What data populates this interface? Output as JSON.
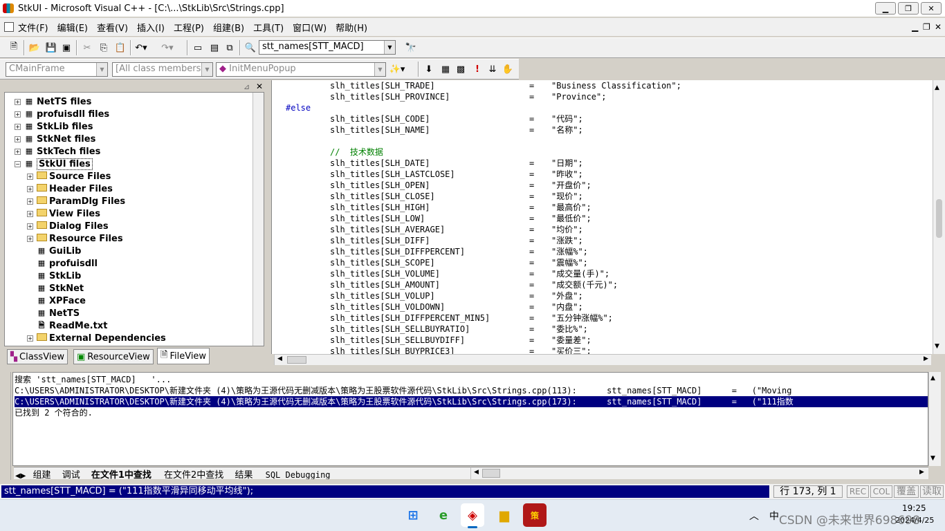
{
  "window": {
    "title": "StkUI - Microsoft Visual C++ - [C:\\...\\StkLib\\Src\\Strings.cpp]"
  },
  "menu": [
    "文件(F)",
    "编辑(E)",
    "查看(V)",
    "插入(I)",
    "工程(P)",
    "组建(B)",
    "工具(T)",
    "窗口(W)",
    "帮助(H)"
  ],
  "toolbar1": {
    "find_combo": "stt_names[STT_MACD]"
  },
  "toolbar2": {
    "class_combo": "CMainFrame",
    "filter_combo": "[All class members]",
    "member_combo": "InitMenuPopup"
  },
  "workspace": {
    "tree": [
      {
        "label": "NetTS files"
      },
      {
        "label": "profuisdll files"
      },
      {
        "label": "StkLib files"
      },
      {
        "label": "StkNet files"
      },
      {
        "label": "StkTech files"
      },
      {
        "label": "StkUI files"
      },
      {
        "label": "Source Files"
      },
      {
        "label": "Header Files"
      },
      {
        "label": "ParamDlg Files"
      },
      {
        "label": "View Files"
      },
      {
        "label": "Dialog Files"
      },
      {
        "label": "Resource Files"
      },
      {
        "label": "GuiLib"
      },
      {
        "label": "profuisdll"
      },
      {
        "label": "StkLib"
      },
      {
        "label": "StkNet"
      },
      {
        "label": "XPFace"
      },
      {
        "label": "NetTS"
      },
      {
        "label": "ReadMe.txt"
      },
      {
        "label": "External Dependencies"
      }
    ],
    "tabs": [
      "ClassView",
      "ResourceView",
      "FileView"
    ]
  },
  "editor": {
    "lines": [
      {
        "key": "slh_titles[SLH_TRADE]",
        "val": "\"Business Classification\";"
      },
      {
        "key": "slh_titles[SLH_PROVINCE]",
        "val": "\"Province\";"
      },
      {
        "pre": "#else"
      },
      {
        "key": "slh_titles[SLH_CODE]",
        "val": "\"代码\";"
      },
      {
        "key": "slh_titles[SLH_NAME]",
        "val": "\"名称\";"
      },
      {
        "blank": ""
      },
      {
        "comment": "//  技术数据"
      },
      {
        "key": "slh_titles[SLH_DATE]",
        "val": "\"日期\";"
      },
      {
        "key": "slh_titles[SLH_LASTCLOSE]",
        "val": "\"昨收\";"
      },
      {
        "key": "slh_titles[SLH_OPEN]",
        "val": "\"开盘价\";"
      },
      {
        "key": "slh_titles[SLH_CLOSE]",
        "val": "\"现价\";"
      },
      {
        "key": "slh_titles[SLH_HIGH]",
        "val": "\"最高价\";"
      },
      {
        "key": "slh_titles[SLH_LOW]",
        "val": "\"最低价\";"
      },
      {
        "key": "slh_titles[SLH_AVERAGE]",
        "val": "\"均价\";"
      },
      {
        "key": "slh_titles[SLH_DIFF]",
        "val": "\"涨跌\";"
      },
      {
        "key": "slh_titles[SLH_DIFFPERCENT]",
        "val": "\"涨幅%\";"
      },
      {
        "key": "slh_titles[SLH_SCOPE]",
        "val": "\"震幅%\";"
      },
      {
        "key": "slh_titles[SLH_VOLUME]",
        "val": "\"成交量(手)\";"
      },
      {
        "key": "slh_titles[SLH_AMOUNT]",
        "val": "\"成交额(千元)\";"
      },
      {
        "key": "slh_titles[SLH_VOLUP]",
        "val": "\"外盘\";"
      },
      {
        "key": "slh_titles[SLH_VOLDOWN]",
        "val": "\"内盘\";"
      },
      {
        "key": "slh_titles[SLH_DIFFPERCENT_MIN5]",
        "val": "\"五分钟涨幅%\";"
      },
      {
        "key": "slh_titles[SLH_SELLBUYRATIO]",
        "val": "\"委比%\";"
      },
      {
        "key": "slh_titles[SLH_SELLBUYDIFF]",
        "val": "\"委量差\";"
      },
      {
        "key": "slh_titles[SLH_BUYPRICE3]",
        "val": "\"买价三\";"
      }
    ],
    "equals": "="
  },
  "output": {
    "lines": [
      "搜索 'stt_names[STT_MACD]   '...",
      "C:\\USERS\\ADMINISTRATOR\\DESKTOP\\新建文件夹 (4)\\策略为王源代码无删减版本\\策略为王股票软件源代码\\StkLib\\Src\\Strings.cpp(113):      stt_names[STT_MACD]      =   (\"Moving",
      "C:\\USERS\\ADMINISTRATOR\\DESKTOP\\新建文件夹 (4)\\策略为王源代码无删减版本\\策略为王股票软件源代码\\StkLib\\Src\\Strings.cpp(173):      stt_names[STT_MACD]      =   (\"111指数",
      "已找到 2 个符合的."
    ],
    "tabs": [
      "组建",
      "调试",
      "在文件1中查找",
      "在文件2中查找",
      "结果",
      "SQL Debugging"
    ]
  },
  "status": {
    "message": "stt_names[STT_MACD]  = (\"111指数平滑异同移动平均线\");",
    "position": "行 173, 列 1",
    "rec": "REC",
    "col": "COL",
    "ovr": "覆盖",
    "read": "读取"
  },
  "taskbar": {
    "time": "19:25",
    "date": "2024/4/25",
    "watermark": "CSDN @未来世界698698",
    "tray_ime": "中"
  }
}
